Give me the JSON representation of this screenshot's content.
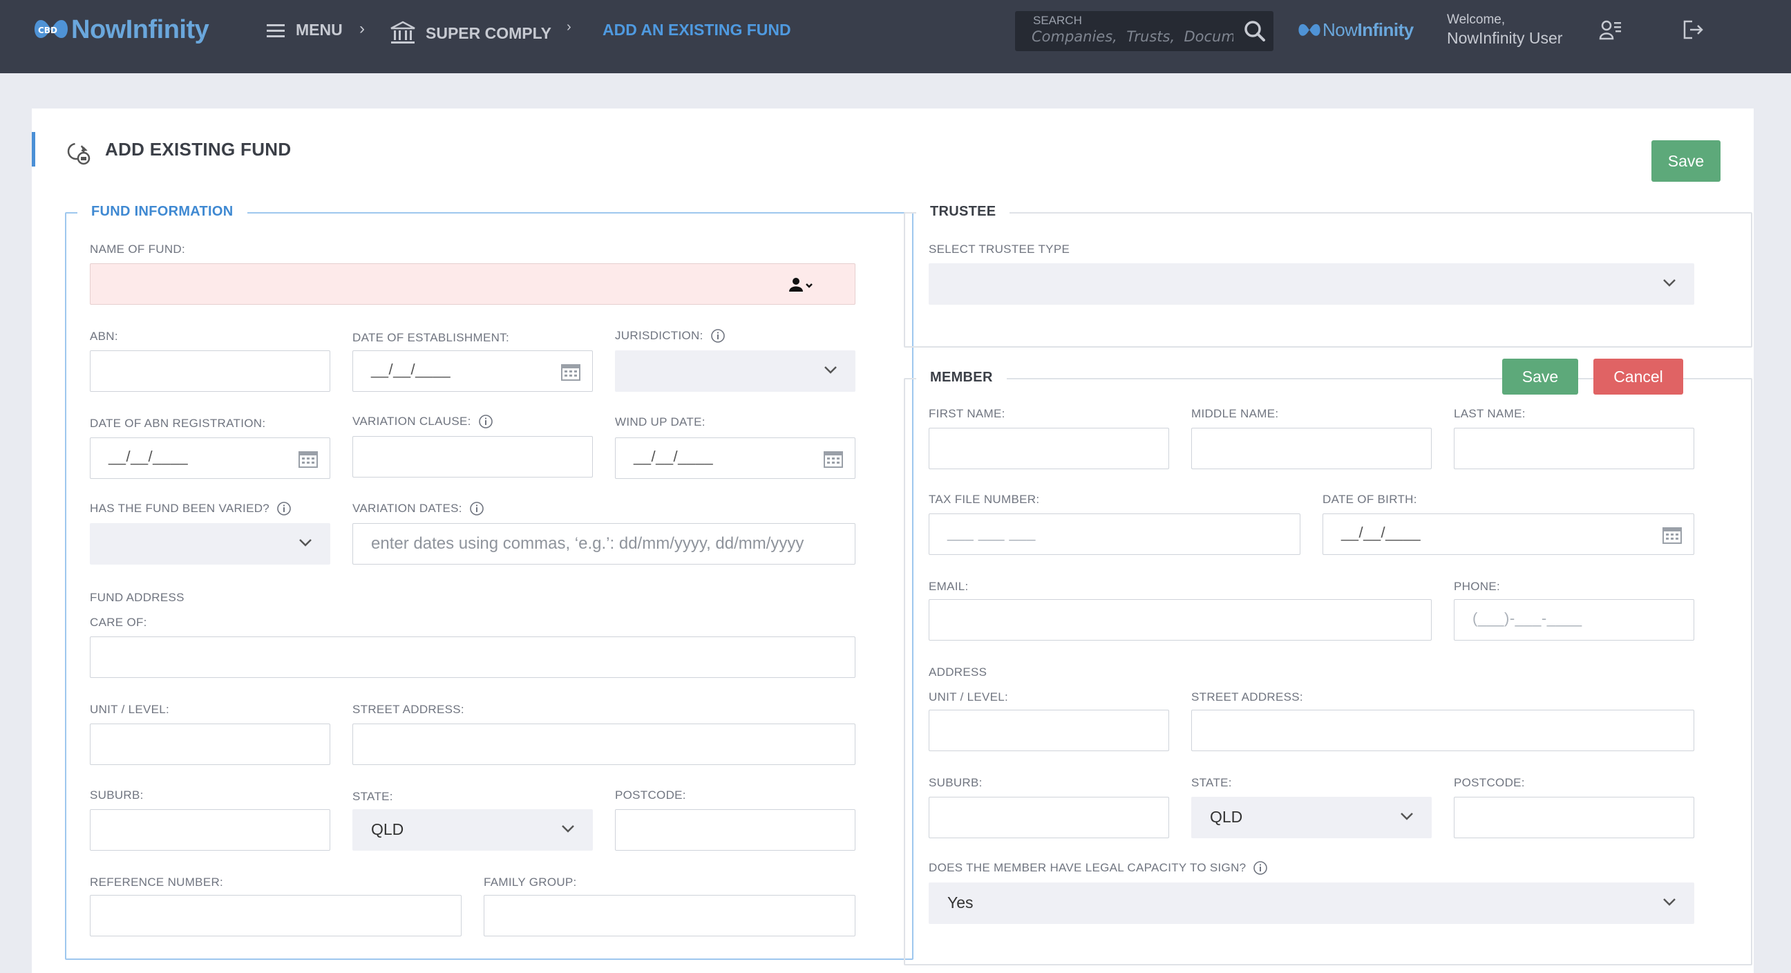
{
  "header": {
    "logo": {
      "now": "Now",
      "infinity": "Infinity"
    },
    "menu_label": "MENU",
    "breadcrumb_module": "SUPER COMPLY",
    "breadcrumb_current": "ADD AN EXISTING FUND",
    "search": {
      "label": "SEARCH",
      "placeholder": "Companies,  Trusts,  Documents"
    },
    "welcome_line1": "Welcome,",
    "welcome_line2": "NowInfinity User"
  },
  "page": {
    "title": "ADD EXISTING FUND",
    "save_label": "Save"
  },
  "fund_info": {
    "legend": "FUND INFORMATION",
    "name_of_fund_label": "NAME OF FUND:",
    "abn_label": "ABN:",
    "date_of_establishment_label": "DATE OF ESTABLISHMENT:",
    "date_mask": "__/__/____",
    "jurisdiction_label": "JURISDICTION:",
    "date_abn_registration_label": "DATE OF ABN REGISTRATION:",
    "variation_clause_label": "VARIATION CLAUSE:",
    "wind_up_date_label": "WIND UP DATE:",
    "fund_varied_label": "HAS THE FUND BEEN VARIED?",
    "variation_dates_label": "VARIATION DATES:",
    "variation_dates_placeholder": "enter dates using commas, ‘e.g.’: dd/mm/yyyy, dd/mm/yyyy",
    "fund_address_heading": "FUND ADDRESS",
    "care_of_label": "CARE OF:",
    "unit_level_label": "UNIT / LEVEL:",
    "street_address_label": "STREET ADDRESS:",
    "suburb_label": "SUBURB:",
    "state_label": "STATE:",
    "state_value": "QLD",
    "postcode_label": "POSTCODE:",
    "reference_number_label": "REFERENCE NUMBER:",
    "family_group_label": "FAMILY GROUP:"
  },
  "trustee": {
    "legend": "TRUSTEE",
    "select_type_label": "SELECT TRUSTEE TYPE"
  },
  "member": {
    "legend": "MEMBER",
    "save_label": "Save",
    "cancel_label": "Cancel",
    "first_name_label": "FIRST NAME:",
    "middle_name_label": "MIDDLE NAME:",
    "last_name_label": "LAST NAME:",
    "tfn_label": "TAX FILE NUMBER:",
    "tfn_mask": "___ ___ ___",
    "dob_label": "DATE OF BIRTH:",
    "date_mask": "__/__/____",
    "email_label": "EMAIL:",
    "phone_label": "PHONE:",
    "phone_mask": "(___)-___-____",
    "address_heading": "ADDRESS",
    "unit_level_label": "UNIT / LEVEL:",
    "street_address_label": "STREET ADDRESS:",
    "suburb_label": "SUBURB:",
    "state_label": "STATE:",
    "state_value": "QLD",
    "postcode_label": "POSTCODE:",
    "legal_capacity_label": "DOES THE MEMBER HAVE LEGAL CAPACITY TO SIGN?",
    "legal_capacity_value": "Yes"
  },
  "colors": {
    "topbar": "#393e4b",
    "accent_blue": "#4a8fd6",
    "save_green": "#5da97a",
    "cancel_red": "#e06364",
    "required_pink": "#fdeaea"
  }
}
